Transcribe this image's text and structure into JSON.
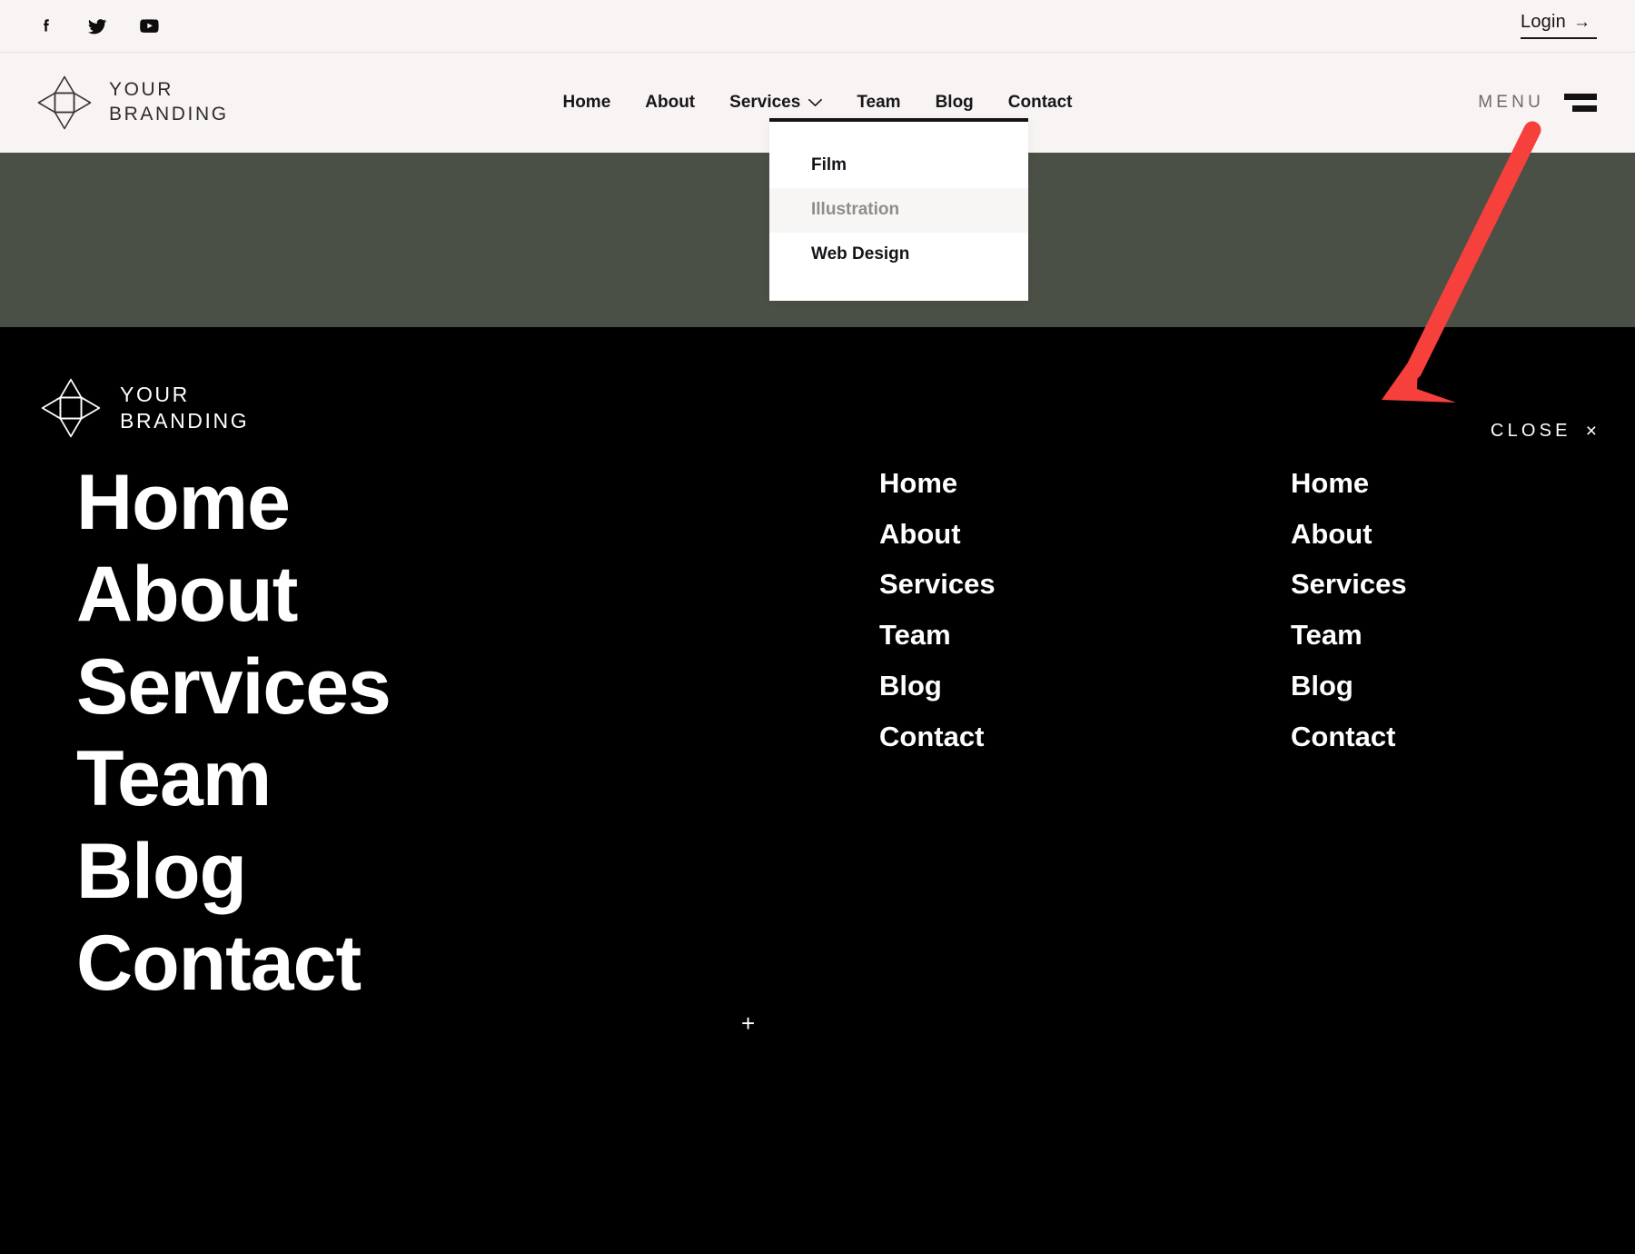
{
  "topbar": {
    "social": [
      {
        "name": "facebook-icon",
        "label": "Facebook"
      },
      {
        "name": "twitter-icon",
        "label": "Twitter"
      },
      {
        "name": "youtube-icon",
        "label": "YouTube"
      }
    ],
    "login_label": "Login",
    "login_arrow": "→"
  },
  "brand": {
    "line1": "YOUR",
    "line2": "BRANDING",
    "logo_icon": "four-point-star-logo"
  },
  "header": {
    "nav": [
      {
        "label": "Home",
        "has_dropdown": false
      },
      {
        "label": "About",
        "has_dropdown": false
      },
      {
        "label": "Services",
        "has_dropdown": true
      },
      {
        "label": "Team",
        "has_dropdown": false
      },
      {
        "label": "Blog",
        "has_dropdown": false
      },
      {
        "label": "Contact",
        "has_dropdown": false
      }
    ],
    "menu_label": "MENU",
    "menu_icon": "hamburger-icon"
  },
  "dropdown": {
    "open_for": "Services",
    "items": [
      {
        "label": "Film",
        "hovered": false
      },
      {
        "label": "Illustration",
        "hovered": true
      },
      {
        "label": "Web Design",
        "hovered": false
      }
    ]
  },
  "overlay": {
    "close_label": "CLOSE",
    "close_symbol": "×",
    "plus_symbol": "+",
    "big_menu": [
      "Home",
      "About",
      "Services",
      "Team",
      "Blog",
      "Contact"
    ],
    "column_mid": [
      "Home",
      "About",
      "Services",
      "Team",
      "Blog",
      "Contact"
    ],
    "column_right": [
      "Home",
      "About",
      "Services",
      "Team",
      "Blog",
      "Contact"
    ]
  },
  "colors": {
    "header_bg": "#f8f4f3",
    "olive_band": "#4a5046",
    "overlay_bg": "#000000",
    "text_dark": "#16141a",
    "text_light": "#ffffff",
    "menu_label": "#6f6b68",
    "dropdown_hover_text": "#8d8d8d",
    "dropdown_hover_bg": "#f7f6f5",
    "annotation_red": "#f6403c"
  },
  "annotation": {
    "type": "arrow",
    "color": "#f6403c",
    "from_label": "menu-toggle",
    "to_label": "overlay-close-area"
  }
}
